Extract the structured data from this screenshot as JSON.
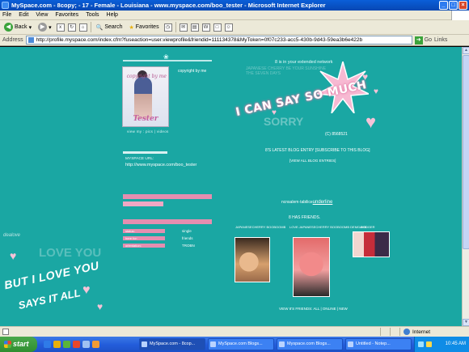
{
  "window": {
    "title": "MySpace.com - 8copy; - 17 - Female - Louisiana - www.myspace.com/boo_tester - Microsoft Internet Explorer",
    "controls": {
      "minimize": "_",
      "maximize": "□",
      "close": "×"
    }
  },
  "menu": [
    "File",
    "Edit",
    "View",
    "Favorites",
    "Tools",
    "Help"
  ],
  "toolbar": {
    "back_label": "Back",
    "search_label": "Search",
    "favorites_label": "Favorites"
  },
  "address": {
    "label": "Address",
    "url": "http://profile.myspace.com/index.cfm?fuseaction=user.viewprofile&friendid=111134378&MyToken=0f07c233-acc5-430b-9d43-59ea3b6e422b",
    "go_label": "Go",
    "links_label": "Links"
  },
  "profile": {
    "photo_caption": "Tester",
    "photo_script": "copyright by me",
    "side_text": "copyright by me",
    "pic_links": "view my : pics | videos",
    "url_label": "MYSPACE URL:",
    "url_value": "http://www.myspace.com/boo_tester",
    "details": [
      {
        "key": "status:",
        "value": "single"
      },
      {
        "key": "here for:",
        "value": "friends"
      },
      {
        "key": "orientation:",
        "value": "TROBN"
      }
    ]
  },
  "banner": {
    "network_text": "8 is in your extended network",
    "faded_text": "JAPANESE CHERRY BE YOUR SUNSHINE THE SEVEN DAYS",
    "main_text": "I CAN SAY SO MUCH",
    "sorry_text": "SORRY",
    "copyright": "(C) 8568521"
  },
  "blog": {
    "entry_text": "8'S LATEST BLOG ENTRY [SUBSCRIBE TO THIS BLOG]",
    "view_all": "[VIEW ALL BLOG ENTRIES]"
  },
  "status_line": {
    "prefix": "ncnsalem·tabilice",
    "underlined": "underline"
  },
  "friends": {
    "title": "8 HAS FRIENDS.",
    "items": [
      {
        "name": "JAPANESECHERRY BOOBOOMB"
      },
      {
        "name": "LOVE.JAPANESECHERRY BOOBOOMB DEMGAHB"
      },
      {
        "name": "BOOGER"
      }
    ],
    "view_all": "VIEW 8'S FRIENDS: ALL | ONLINE | NEW"
  },
  "graffiti": {
    "top_text": "dealove",
    "main": "BUT I LOVE YOU",
    "sub": "SAYS IT ALL",
    "bg": "LOVE YOU"
  },
  "statusbar": {
    "zone": "Internet"
  },
  "taskbar": {
    "start": "start",
    "tasks": [
      "MySpace.com - 8cop...",
      "MySpace.com Blogs...",
      "Myspace.com Blogs...",
      "Untitled - Notep..."
    ],
    "clock": "10:45 AM"
  },
  "colors": {
    "page_bg": "#1aa7a3",
    "accent_pink": "#e58eb0",
    "xp_blue": "#245edb"
  }
}
